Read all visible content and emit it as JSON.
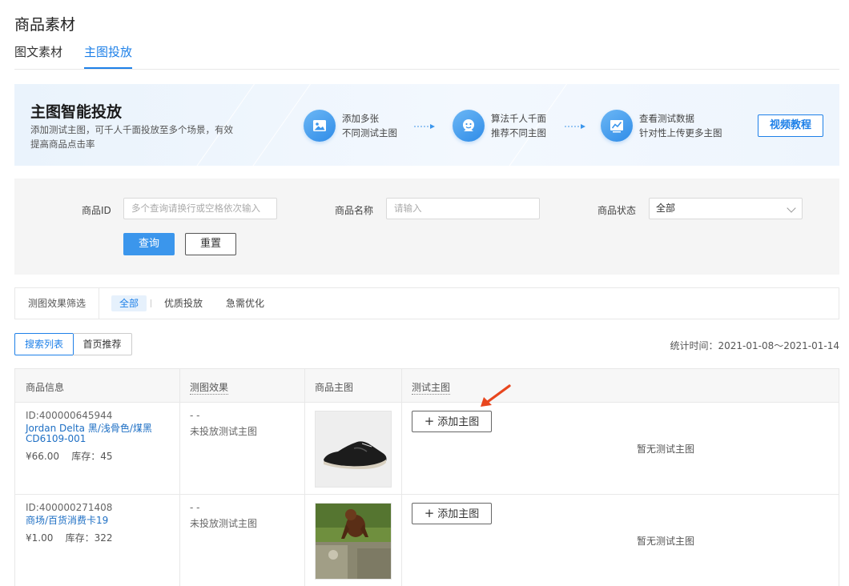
{
  "page": {
    "title": "商品素材"
  },
  "tabs": [
    {
      "label": "图文素材",
      "active": false
    },
    {
      "label": "主图投放",
      "active": true
    }
  ],
  "banner": {
    "title": "主图智能投放",
    "desc": "添加测试主图，可千人千面投放至多个场景，有效提高商品点击率",
    "steps": [
      {
        "icon": "image-icon",
        "line1": "添加多张",
        "line2": "不同测试主图"
      },
      {
        "icon": "user-face-icon",
        "line1": "算法千人千面",
        "line2": "推荐不同主图"
      },
      {
        "icon": "chart-icon",
        "line1": "查看测试数据",
        "line2": "针对性上传更多主图"
      }
    ],
    "video_button": "视频教程"
  },
  "filters": {
    "product_id_label": "商品ID",
    "product_id_placeholder": "多个查询请换行或空格依次输入",
    "product_name_label": "商品名称",
    "product_name_placeholder": "请输入",
    "status_label": "商品状态",
    "status_value": "全部",
    "query_button": "查询",
    "reset_button": "重置"
  },
  "effect_filter": {
    "label": "测图效果筛选",
    "options": [
      "全部",
      "优质投放",
      "急需优化"
    ],
    "selected": "全部"
  },
  "list_tabs": [
    "搜索列表",
    "首页推荐"
  ],
  "stat_time": "统计时间：2021-01-08～2021-01-14",
  "table": {
    "headers": [
      "商品信息",
      "测图效果",
      "商品主图",
      "测试主图"
    ],
    "add_button": "添加主图",
    "rows": [
      {
        "id": "ID:400000645944",
        "name": "Jordan Delta 黑/浅骨色/煤黑 CD6109-001",
        "price": "¥66.00",
        "stock": "库存：45",
        "effect_dash": "- -",
        "effect": "未投放测试主图",
        "test_image": "暂无测试主图"
      },
      {
        "id": "ID:400000271408",
        "name": "商场/百货消费卡19",
        "price": "¥1.00",
        "stock": "库存：322",
        "effect_dash": "- -",
        "effect": "未投放测试主图",
        "test_image": "暂无测试主图"
      }
    ]
  },
  "colors": {
    "accent": "#1e80e8",
    "annotation_arrow": "#e8461e"
  }
}
